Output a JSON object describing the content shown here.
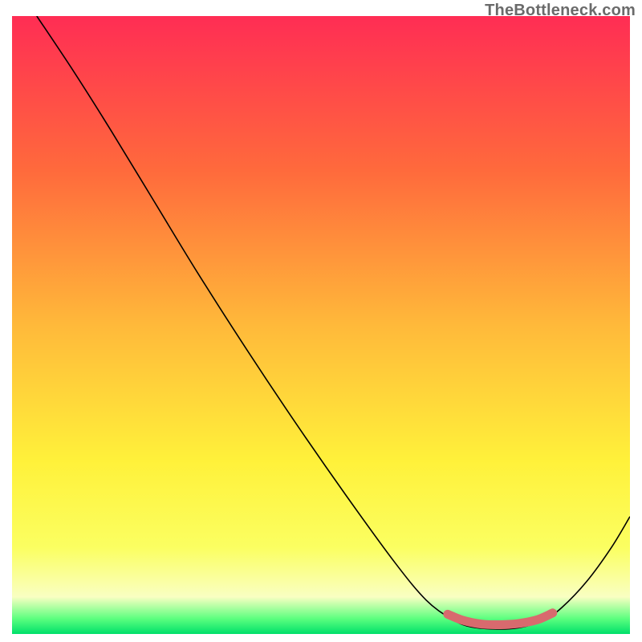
{
  "attribution": "TheBottleneck.com",
  "chart_data": {
    "type": "line",
    "title": "",
    "xlabel": "",
    "ylabel": "",
    "xlim": [
      0,
      100
    ],
    "ylim": [
      0,
      100
    ],
    "grid": false,
    "legend": false,
    "background_gradient": {
      "stops": [
        {
          "offset": 0.0,
          "color": "#ff2d54"
        },
        {
          "offset": 0.25,
          "color": "#ff6a3c"
        },
        {
          "offset": 0.5,
          "color": "#ffb93a"
        },
        {
          "offset": 0.72,
          "color": "#fff13a"
        },
        {
          "offset": 0.86,
          "color": "#fbff61"
        },
        {
          "offset": 0.94,
          "color": "#f9ffc2"
        },
        {
          "offset": 0.975,
          "color": "#5dff7f"
        },
        {
          "offset": 1.0,
          "color": "#00e06a"
        }
      ]
    },
    "series": [
      {
        "name": "bottleneck-curve",
        "stroke": "#000000",
        "stroke_width": 1.6,
        "points": [
          {
            "x": 4,
            "y": 100
          },
          {
            "x": 10,
            "y": 91
          },
          {
            "x": 16,
            "y": 81.5
          },
          {
            "x": 23,
            "y": 70
          },
          {
            "x": 30,
            "y": 58.5
          },
          {
            "x": 38,
            "y": 46
          },
          {
            "x": 46,
            "y": 34
          },
          {
            "x": 54,
            "y": 22.5
          },
          {
            "x": 62,
            "y": 11.5
          },
          {
            "x": 67,
            "y": 5.5
          },
          {
            "x": 71,
            "y": 2.5
          },
          {
            "x": 74,
            "y": 1.2
          },
          {
            "x": 78,
            "y": 0.8
          },
          {
            "x": 82,
            "y": 1.0
          },
          {
            "x": 86,
            "y": 2.2
          },
          {
            "x": 89,
            "y": 4.3
          },
          {
            "x": 93,
            "y": 8.5
          },
          {
            "x": 97,
            "y": 14
          },
          {
            "x": 100,
            "y": 19
          }
        ]
      },
      {
        "name": "optimal-band-marker",
        "stroke": "#d86a6e",
        "stroke_width": 11,
        "linecap": "round",
        "points": [
          {
            "x": 70.5,
            "y": 3.2
          },
          {
            "x": 73,
            "y": 2.2
          },
          {
            "x": 76,
            "y": 1.6
          },
          {
            "x": 79,
            "y": 1.5
          },
          {
            "x": 82,
            "y": 1.7
          },
          {
            "x": 85,
            "y": 2.3
          },
          {
            "x": 87.5,
            "y": 3.4
          }
        ]
      }
    ]
  }
}
